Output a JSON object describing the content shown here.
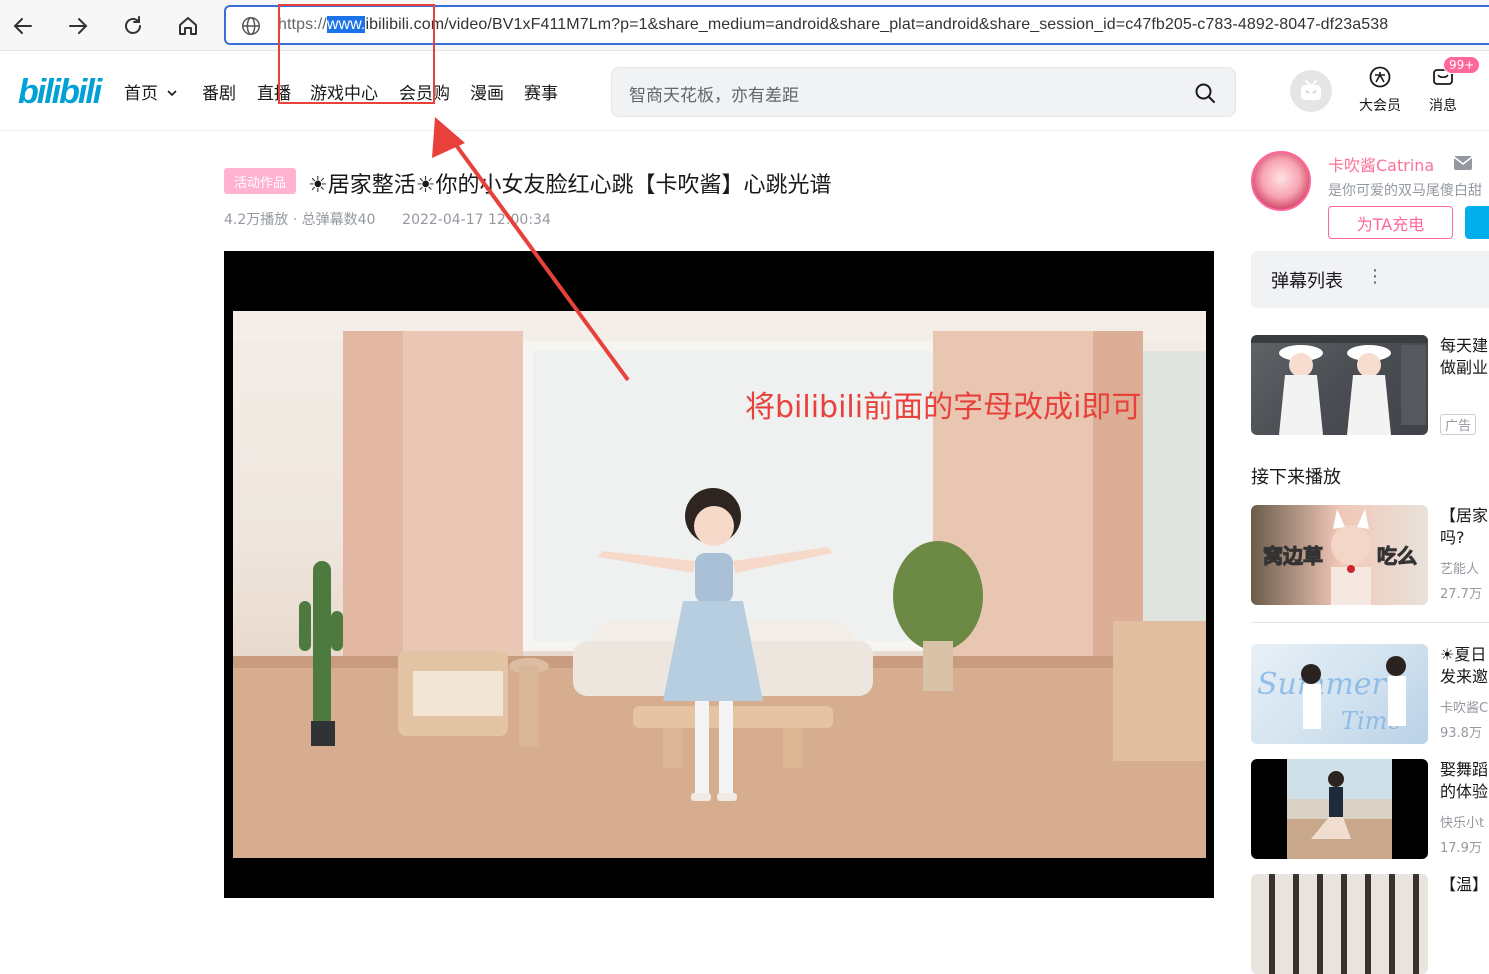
{
  "browser": {
    "url_prefix": "https://",
    "url_selected": "www.",
    "url_rest": "ibilibili.com/video/BV1xF411M7Lm?p=1&share_medium=android&share_plat=android&share_session_id=c47fb205-c783-4892-8047-df23a538"
  },
  "header": {
    "logo": "bilibili",
    "nav": [
      "首页",
      "番剧",
      "直播",
      "游戏中心",
      "会员购",
      "漫画",
      "赛事"
    ],
    "search_placeholder": "智商天花板，亦有差距",
    "vip_label": "大会员",
    "message_label": "消息",
    "message_badge": "99+"
  },
  "video": {
    "tag": "活动作品",
    "title": "☀居家整活☀你的小女友脸红心跳【卡吹酱】心跳光谱",
    "views": "4.2万播放",
    "danmaku_count": "总弹幕数40",
    "date": "2022-04-17 12:00:34"
  },
  "annotation": {
    "text": "将bilibili前面的字母改成i即可",
    "color": "#e8413c"
  },
  "uploader": {
    "name": "卡吹酱Catrina",
    "desc": "是你可爱的双马尾傻白甜",
    "charge_label": "为TA充电"
  },
  "danmaku_panel": {
    "label": "弹幕列表"
  },
  "sidebar": {
    "ad": {
      "t1": "每天建",
      "t2": "做副业",
      "tag": "广告"
    },
    "next_label": "接下来播放",
    "items": [
      {
        "t1": "【居家",
        "t2": "吗?",
        "up": "艺能人",
        "views": "27.7万"
      },
      {
        "t1": "☀夏日",
        "t2": "发来邀",
        "up": "卡吹酱C",
        "views": "93.8万"
      },
      {
        "t1": "娶舞蹈",
        "t2": "的体验",
        "up": "快乐小t",
        "views": "17.9万"
      },
      {
        "t1": "【温】",
        "t2": "",
        "up": "",
        "views": ""
      }
    ]
  },
  "colors": {
    "accent_pink": "#fb7299",
    "brand_blue": "#00a1d6",
    "annotation_red": "#e8413c"
  }
}
